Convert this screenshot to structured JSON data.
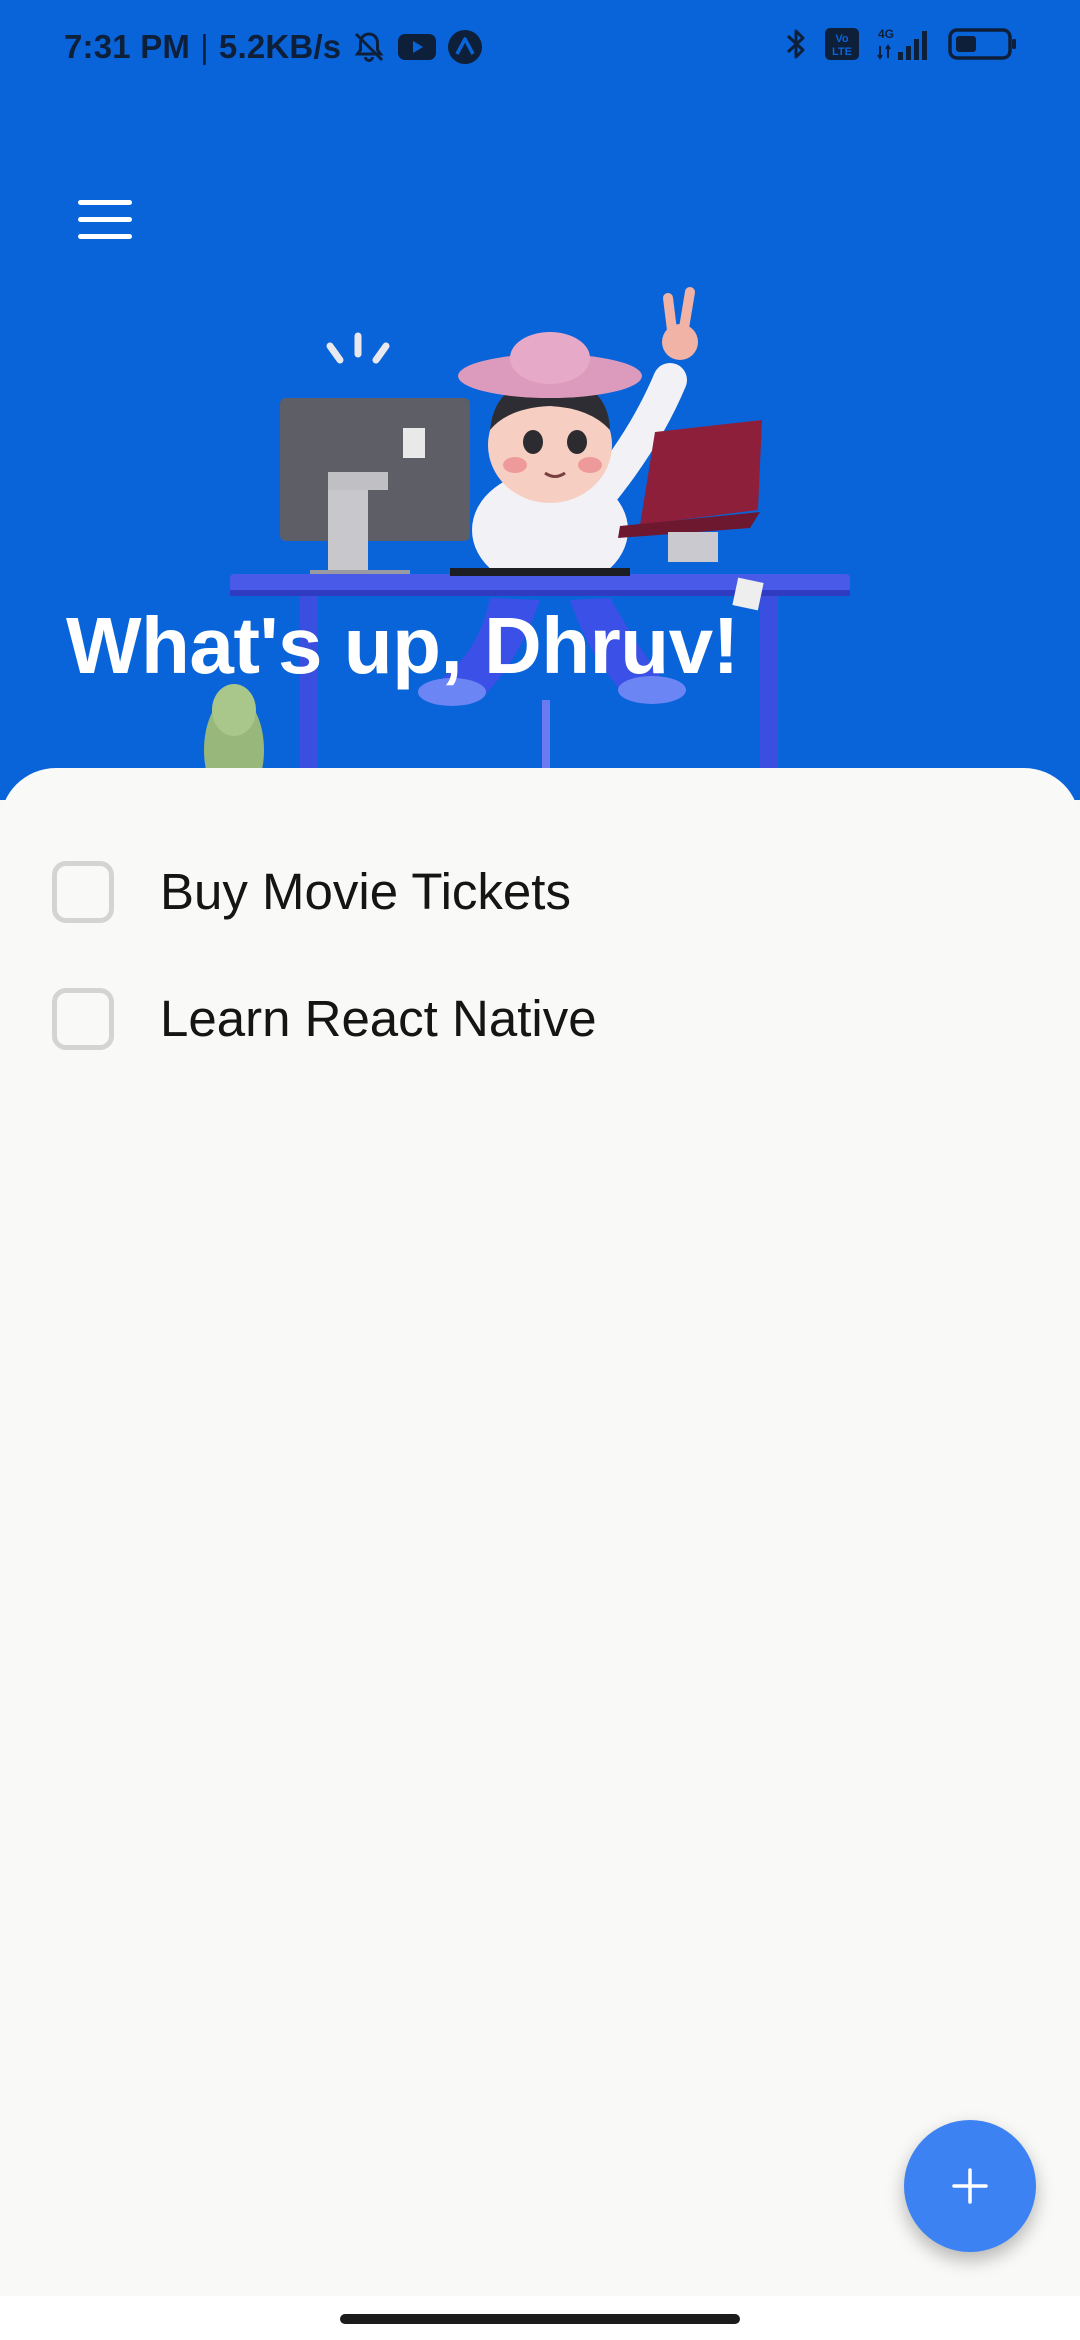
{
  "status_bar": {
    "time": "7:31 PM",
    "network_speed": "5.2KB/s",
    "separator": "|",
    "left_icons": [
      "bell-off-icon",
      "youtube-icon",
      "app-a-icon"
    ],
    "right_icons": [
      "bluetooth-icon",
      "volte-icon",
      "signal-4g-icon",
      "battery-icon"
    ],
    "signal_label": "4G",
    "volte_label": "Vo LTE"
  },
  "header": {
    "background_color": "#0a64d9",
    "greeting": "What's up, Dhruv!",
    "menu_icon": "hamburger-menu-icon",
    "illustration": "developer-at-desk-illustration"
  },
  "tasks": [
    {
      "label": "Buy Movie Tickets",
      "checked": false
    },
    {
      "label": "Learn React Native",
      "checked": false
    }
  ],
  "fab": {
    "icon": "plus-icon",
    "color": "#3d82f2"
  }
}
